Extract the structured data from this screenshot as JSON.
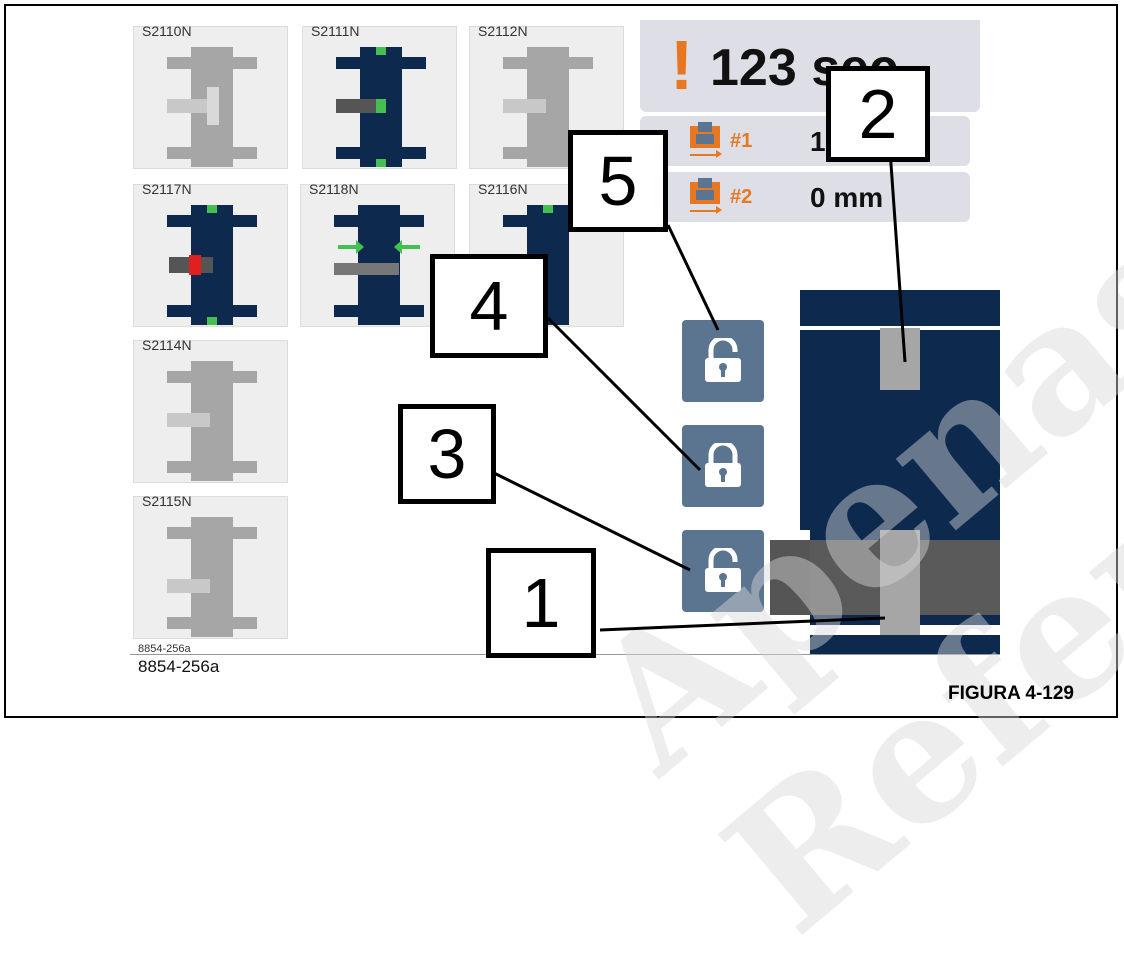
{
  "tiles": [
    {
      "label": "S2110N",
      "state": "inactive"
    },
    {
      "label": "S2111N",
      "state": "active"
    },
    {
      "label": "S2112N",
      "state": "inactive"
    },
    {
      "label": "S2117N",
      "state": "active-red"
    },
    {
      "label": "S2118N",
      "state": "active-arrows"
    },
    {
      "label": "S2116N",
      "state": "active"
    },
    {
      "label": "S2114N",
      "state": "inactive"
    },
    {
      "label": "S2115N",
      "state": "inactive"
    }
  ],
  "timer": {
    "icon": "exclamation",
    "text": "123 sec"
  },
  "positions": [
    {
      "num": "#1",
      "value": "1 mm"
    },
    {
      "num": "#2",
      "value": "0 mm"
    }
  ],
  "locks": [
    {
      "state": "unlocked"
    },
    {
      "state": "locked"
    },
    {
      "state": "unlocked"
    }
  ],
  "callouts": [
    "1",
    "2",
    "3",
    "4",
    "5"
  ],
  "figure": {
    "id_small": "8854-256a",
    "id": "8854-256a",
    "label": "FIGURA 4-129"
  },
  "watermark": "Apenas Referência",
  "colors": {
    "navy": "#0d2a4e",
    "orange": "#e87722",
    "lock_blue": "#5b7591",
    "gray_part": "#a6a6a6",
    "tile_bg": "#eeeeee",
    "green": "#44c050",
    "red": "#e02020"
  }
}
